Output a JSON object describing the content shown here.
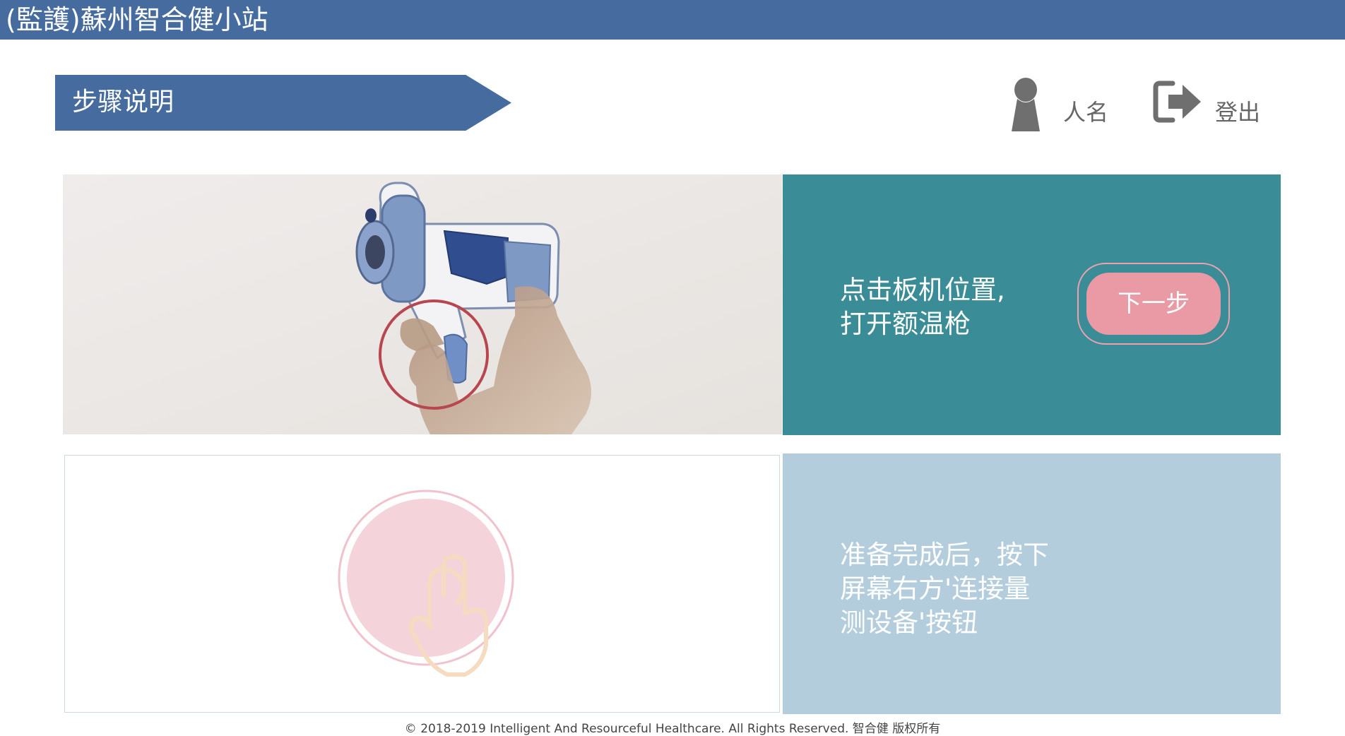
{
  "header": {
    "title": "(監護)蘇州智合健小站"
  },
  "step_banner": {
    "label": "步骤说明"
  },
  "user": {
    "name": "人名",
    "icon": "user-icon"
  },
  "logout": {
    "label": "登出",
    "icon": "logout-icon"
  },
  "step1": {
    "illustration": "infrared-thermometer-illustration",
    "instruction_lines": [
      "点击板机位置,",
      "打开额温枪"
    ],
    "next_button": "下一步"
  },
  "step2": {
    "illustration": "tap-button-illustration",
    "instruction_lines": [
      "准备完成后，按下",
      "屏幕右方'连接量",
      "测设备'按钮"
    ]
  },
  "footer": {
    "copyright": "© 2018-2019 Intelligent And Resourceful Healthcare. All Rights Reserved. 智合健 版权所有"
  },
  "colors": {
    "header_bg": "#466b9f",
    "teal_panel": "#3a8c96",
    "light_blue_panel": "#b4cddd",
    "pink_button": "#e99aa5",
    "icon_gray": "#6f6f6f"
  }
}
